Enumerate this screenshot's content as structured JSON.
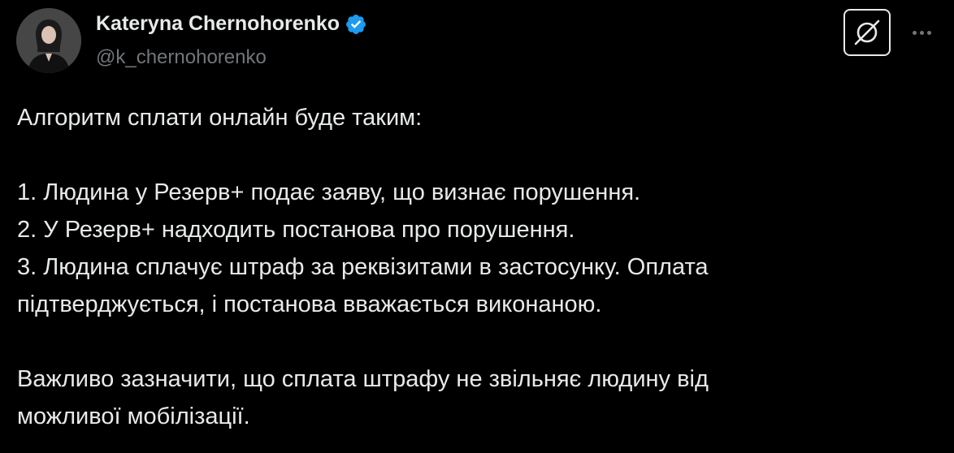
{
  "author": {
    "display_name": "Kateryna Chernohorenko",
    "handle": "@k_chernohorenko",
    "verified_icon": "verified-badge-icon",
    "verified_color": "#1d9bf0"
  },
  "actions": {
    "grok_icon": "grok-icon",
    "more_icon": "more-horizontal-icon"
  },
  "post": {
    "intro": "Алгоритм сплати онлайн буде таким:",
    "steps": [
      "1. Людина у Резерв+ подає заяву, що визнає порушення.",
      "2. У Резерв+ надходить постанова про порушення.",
      "3. Людина сплачує штраф за реквізитами в застосунку. Оплата",
      "підтверджується, і постанова вважається виконаною."
    ],
    "note_lines": [
      "Важливо зазначити, що сплата штрафу не звільняє людину від",
      "можливої мобілізації."
    ]
  },
  "colors": {
    "background": "#000000",
    "primary_text": "#e7e9ea",
    "secondary_text": "#71767b"
  }
}
